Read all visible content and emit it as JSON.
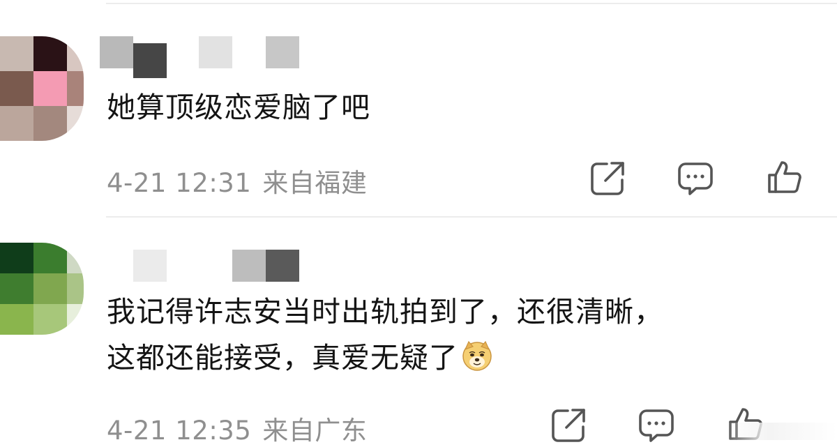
{
  "comments": [
    {
      "text_lines": [
        "她算顶级恋爱脑了吧"
      ],
      "time": "4-21 12:31",
      "location": "来自福建"
    },
    {
      "text_lines": [
        "我记得许志安当时出轨拍到了，还很清晰，",
        "这都还能接受，真爱无疑了"
      ],
      "emoji": "doge-emoji",
      "time": "4-21 12:35",
      "location": "来自广东"
    }
  ],
  "actions": {
    "share_icon": "share-icon",
    "comment_icon": "comment-icon",
    "like_icon": "thumbs-up-icon"
  },
  "colors": {
    "text": "#141414",
    "meta": "#8f8f8f",
    "icon": "#555555",
    "divider": "#ececec",
    "background": "#ffffff"
  }
}
